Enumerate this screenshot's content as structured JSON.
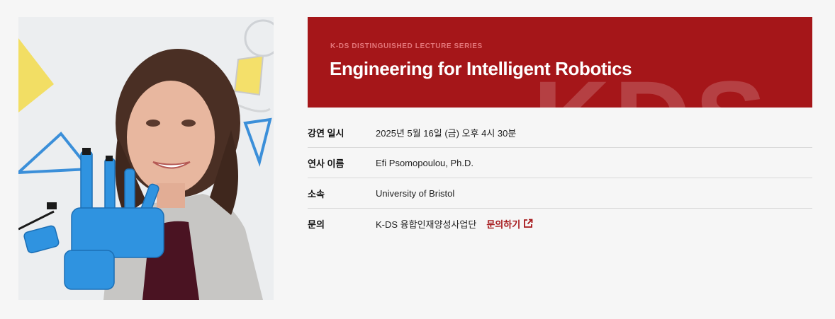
{
  "banner": {
    "kicker": "K-DS DISTINGUISHED LECTURE SERIES",
    "title": "Engineering for Intelligent Robotics",
    "watermark": "KDS"
  },
  "info": {
    "rows": [
      {
        "label": "강연 일시",
        "value": "2025년 5월 16일 (금) 오후 4시 30분"
      },
      {
        "label": "연사 이름",
        "value": "Efi Psomopoulou, Ph.D."
      },
      {
        "label": "소속",
        "value": "University of Bristol"
      },
      {
        "label": "문의",
        "value": "K-DS 융합인재양성사업단",
        "link_label": "문의하기",
        "link_icon": "external-link-icon"
      }
    ]
  },
  "colors": {
    "accent": "#a51619",
    "background": "#f6f6f6"
  }
}
